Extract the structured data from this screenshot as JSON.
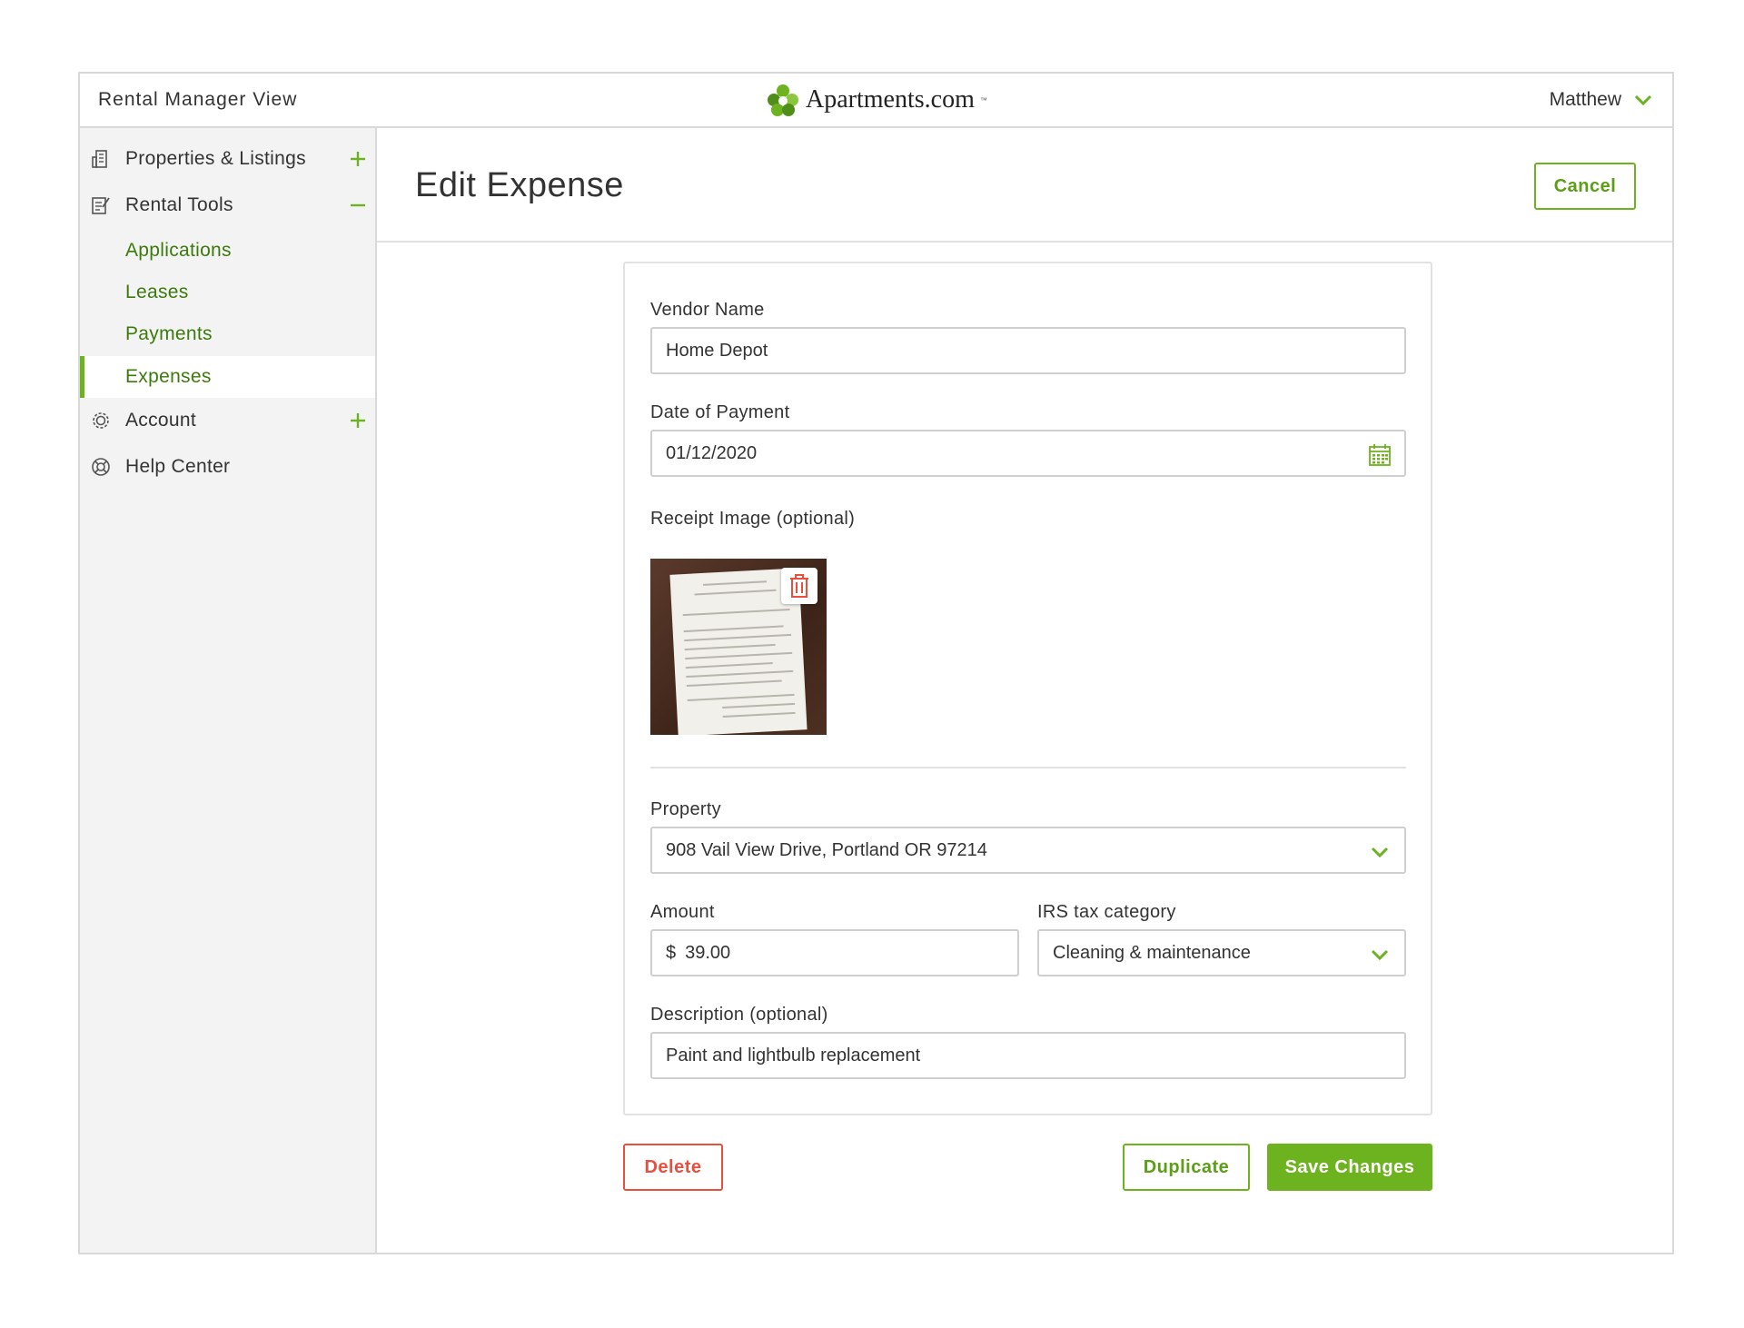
{
  "header": {
    "app_title": "Rental Manager View",
    "logo_text": "Apartments.com",
    "logo_tm": "™",
    "user_name": "Matthew"
  },
  "sidebar": {
    "items": [
      {
        "label": "Properties & Listings",
        "icon": "building-icon",
        "toggle": "plus"
      },
      {
        "label": "Rental Tools",
        "icon": "document-edit-icon",
        "toggle": "minus"
      },
      {
        "label": "Account",
        "icon": "gear-icon",
        "toggle": "plus"
      },
      {
        "label": "Help Center",
        "icon": "lifebuoy-icon",
        "toggle": "none"
      }
    ],
    "subitems": [
      {
        "label": "Applications",
        "active": false
      },
      {
        "label": "Leases",
        "active": false
      },
      {
        "label": "Payments",
        "active": false
      },
      {
        "label": "Expenses",
        "active": true
      }
    ]
  },
  "main": {
    "title": "Edit Expense",
    "cancel_label": "Cancel"
  },
  "form": {
    "vendor_label": "Vendor Name",
    "vendor_value": "Home Depot",
    "date_label": "Date of Payment",
    "date_value": "01/12/2020",
    "receipt_label": "Receipt Image (optional)",
    "property_label": "Property",
    "property_value": "908 Vail View Drive, Portland OR 97214",
    "amount_label": "Amount",
    "amount_currency": "$",
    "amount_value": "39.00",
    "irs_label": "IRS tax category",
    "irs_value": "Cleaning & maintenance",
    "description_label": "Description (optional)",
    "description_value": "Paint and lightbulb replacement"
  },
  "actions": {
    "delete_label": "Delete",
    "duplicate_label": "Duplicate",
    "save_label": "Save Changes"
  },
  "colors": {
    "accent_green": "#6cb31f",
    "link_green": "#3d7a0e",
    "danger_red": "#e8503d"
  }
}
